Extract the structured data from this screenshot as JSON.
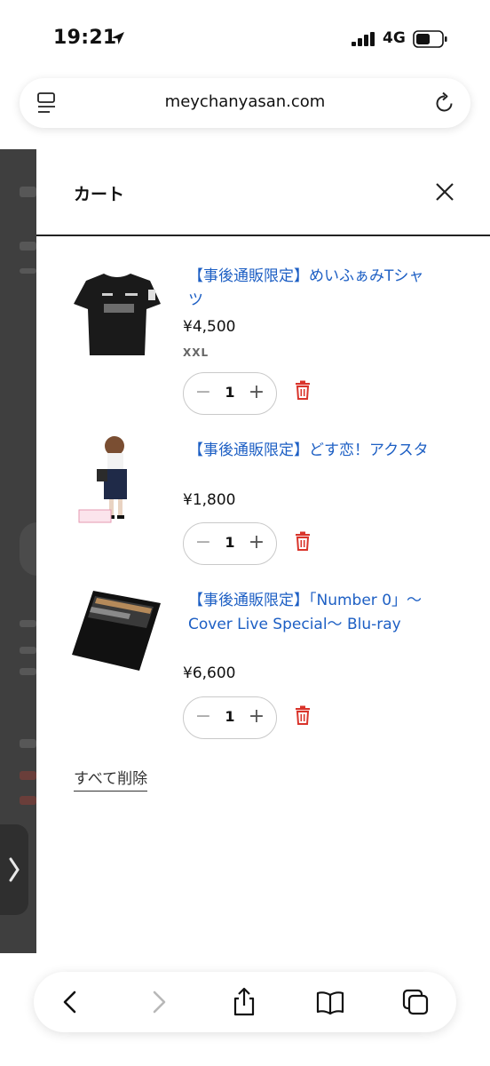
{
  "status": {
    "time": "19:21",
    "network": "4G"
  },
  "browser": {
    "url": "meychanyasan.com"
  },
  "cart": {
    "title": "カート",
    "clear_all_label": "すべて削除",
    "items": [
      {
        "title": "【事後通販限定】めいふぁみTシャツ",
        "price": "¥4,500",
        "variant": "XXL",
        "quantity": "1"
      },
      {
        "title": "【事後通販限定】どす恋！アクスタ",
        "price": "¥1,800",
        "quantity": "1"
      },
      {
        "title": "【事後通販限定】「Number 0」〜Cover Live Special〜 Blu-ray",
        "price": "¥6,600",
        "quantity": "1"
      }
    ]
  },
  "colors": {
    "link": "#1d5fc4",
    "trash": "#d9342b",
    "backdrop": "#3f3f3f"
  }
}
